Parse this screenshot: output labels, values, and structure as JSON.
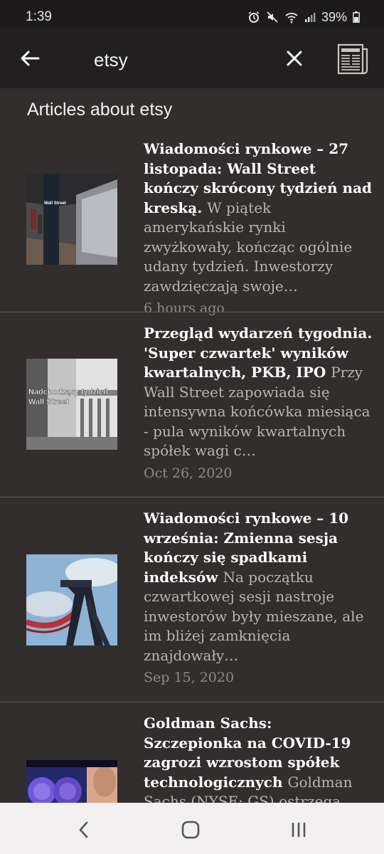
{
  "status": {
    "time": "1:39",
    "battery": "39%",
    "icons": [
      "alarm-icon",
      "mute-icon",
      "wifi-icon",
      "signal-icon",
      "battery-icon"
    ]
  },
  "toolbar": {
    "back_icon": "arrow-left-icon",
    "query": "etsy",
    "clear_icon": "close-icon",
    "news_icon": "newspaper-icon"
  },
  "section_title": "Articles about etsy",
  "articles": [
    {
      "headline": "Wiadomości rynkowe – 27 listopada: Wall Street kończy skrócony tydzień nad kreską.",
      "snippet": "W piątek amerykańskie rynki zwyżkowały, kończąc ogólnie udany tydzień. Inwestorzy zawdzięczają swoje…",
      "time": "6 hours ago",
      "thumb_label": "Wall Street"
    },
    {
      "headline": "Przegląd wydarzeń tygodnia. 'Super czwartek' wyników kwartalnych, PKB, IPO",
      "snippet": "Przy Wall Street zapowiada się intensywna końcówka miesiąca - pula wyników kwartalnych spółek wagi c…",
      "time": "Oct 26, 2020",
      "thumb_label_1": "Nadchodzący tydzień",
      "thumb_label_2": "Wall Street"
    },
    {
      "headline": "Wiadomości rynkowe – 10 września: Zmienna sesja kończy się spadkami indeksów",
      "snippet": "Na początku czwartkowej sesji nastroje inwestorów były mieszane, ale im bliżej zamknięcia znajdowały…",
      "time": "Sep 15, 2020"
    },
    {
      "headline": "Goldman Sachs: Szczepionka na COVID-19 zagrozi wzrostom spółek technologicznych",
      "snippet": "Goldman Sachs (NYSE: GS) ostrzega"
    }
  ],
  "nav": {
    "back_icon": "nav-back-icon",
    "home_icon": "nav-home-icon",
    "recents_icon": "nav-recents-icon"
  }
}
